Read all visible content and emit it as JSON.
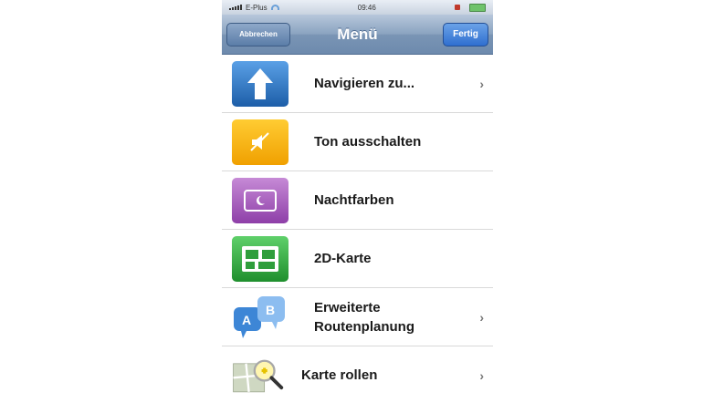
{
  "status": {
    "carrier": "E-Plus",
    "time": "09:46"
  },
  "navbar": {
    "cancel_label": "Abbrechen",
    "title": "Menü",
    "done_label": "Fertig"
  },
  "menu": {
    "items": [
      {
        "label": "Navigieren zu...",
        "icon": "arrow-up-icon",
        "chevron": true
      },
      {
        "label": "Ton ausschalten",
        "icon": "mute-speaker-icon",
        "chevron": false
      },
      {
        "label": "Nachtfarben",
        "icon": "night-colors-icon",
        "chevron": false
      },
      {
        "label": "2D-Karte",
        "icon": "map-2d-icon",
        "chevron": false
      },
      {
        "label": "Erweiterte Routenplanung",
        "icon": "route-planning-icon",
        "chevron": true
      },
      {
        "label": "Karte rollen",
        "icon": "map-browse-icon",
        "chevron": true
      }
    ]
  },
  "colors": {
    "nav_bar": "#7a95b5",
    "done_button": "#2f6fd0",
    "icon_blue": "#1d5ea8",
    "icon_orange": "#f0a000",
    "icon_purple": "#8e3fa8",
    "icon_green": "#1f8f2d"
  }
}
